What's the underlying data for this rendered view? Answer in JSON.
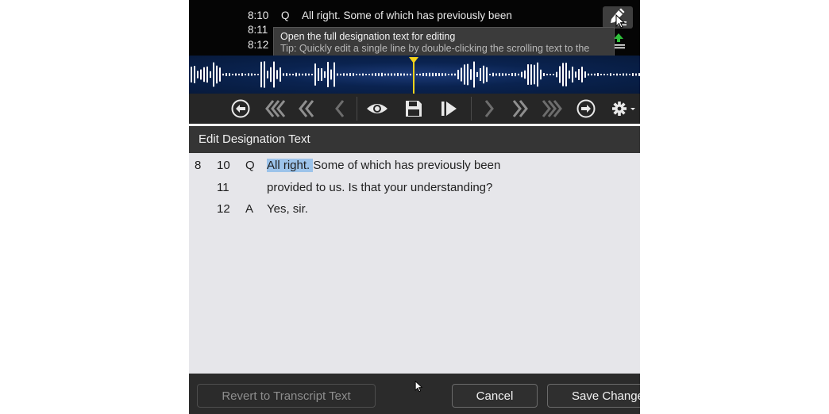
{
  "scroller": {
    "lines": [
      {
        "pageline": "8:10",
        "speaker": "Q",
        "text": "All right.  Some of which has previously been"
      },
      {
        "pageline": "8:11",
        "speaker": "",
        "text": ""
      },
      {
        "pageline": "8:12",
        "speaker": "",
        "text": ""
      }
    ],
    "edit_icon": "pencil-lines-icon",
    "upload_icon": "upload-lines-icon"
  },
  "tooltip": {
    "title": "Open the full designation text for editing",
    "tip": "Tip: Quickly edit a single line by double-clicking the scrolling text to the left."
  },
  "waveform": {
    "playhead_color": "#f2d21b",
    "bar_color": "#ffffff"
  },
  "toolbar": {
    "icons": [
      "prev-clip-icon",
      "rewind-fast-icon",
      "rewind-icon",
      "step-back-icon",
      "preview-eye-icon",
      "save-icon",
      "play-icon",
      "step-forward-icon",
      "forward-icon",
      "forward-fast-icon",
      "next-clip-icon",
      "settings-gear-icon"
    ]
  },
  "dialog": {
    "title": "Edit Designation Text",
    "lines": [
      {
        "page": "8",
        "line": "10",
        "speaker": "Q",
        "highlight": "All right. ",
        "text": " Some of which has previously been"
      },
      {
        "page": "",
        "line": "11",
        "speaker": "",
        "highlight": "",
        "text": "provided to us.  Is that your understanding?"
      },
      {
        "page": "",
        "line": "12",
        "speaker": "A",
        "highlight": "",
        "text": "Yes, sir."
      }
    ],
    "buttons": {
      "revert": "Revert to Transcript Text",
      "cancel": "Cancel",
      "save": "Save Changes"
    }
  },
  "colors": {
    "highlight": "#9cc3ea",
    "header_bg": "#353535",
    "body_bg": "#e6e6ea"
  }
}
